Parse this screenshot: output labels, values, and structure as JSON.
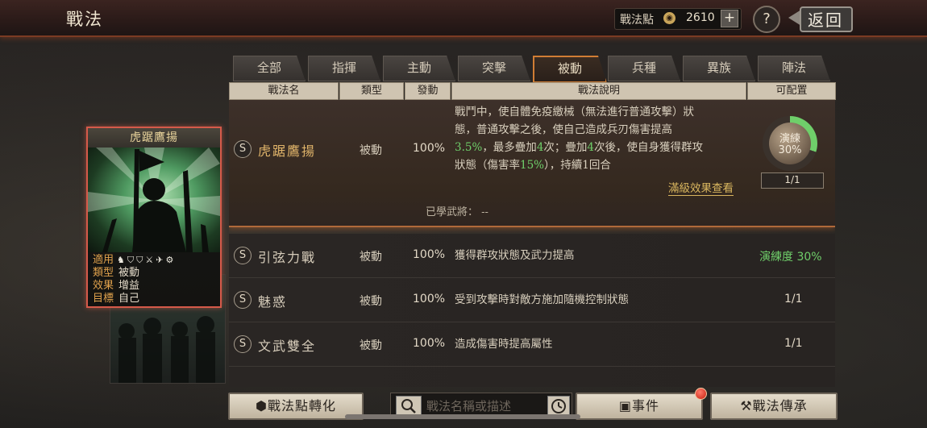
{
  "header": {
    "title": "戰法",
    "points_label": "戰法點",
    "points_value": "2610",
    "plus": "+",
    "help": "?",
    "back": "返回"
  },
  "tabs": [
    {
      "label": "全部",
      "active": false
    },
    {
      "label": "指揮",
      "active": false
    },
    {
      "label": "主動",
      "active": false
    },
    {
      "label": "突擊",
      "active": false
    },
    {
      "label": "被動",
      "active": true
    },
    {
      "label": "兵種",
      "active": false
    },
    {
      "label": "異族",
      "active": false
    },
    {
      "label": "陣法",
      "active": false
    }
  ],
  "columns": {
    "name": "戰法名",
    "type": "類型",
    "rate": "發動",
    "desc": "戰法說明",
    "config": "可配置"
  },
  "selected": {
    "grade": "S",
    "name": "虎踞鷹揚",
    "type": "被動",
    "rate": "100%",
    "desc_lines": [
      [
        "戰鬥中，使自體免疫繳械（無法進行普通攻擊）狀"
      ],
      [
        "態，普通攻擊之後，使自己造成兵刃傷害提高"
      ],
      [
        "3.5%",
        "，最多疊加",
        "4",
        "次；疊加",
        "4",
        "次後，使自身獲得群攻"
      ],
      [
        "狀態（傷害率",
        "15%",
        "），持續",
        "1",
        "回合"
      ]
    ],
    "max_effect_link": "滿級效果查看",
    "learned_label": "已學武將：",
    "learned_value": "--",
    "practice_label": "演練",
    "practice_percent": "30%",
    "practice_fill": 0.3,
    "practice_count": "1/1"
  },
  "rows": [
    {
      "grade": "S",
      "name": "引弦力戰",
      "type": "被動",
      "rate": "100%",
      "desc": "獲得群攻狀態及武力提高",
      "status": "演練度 30%",
      "status_color": "#6fcf6a"
    },
    {
      "grade": "S",
      "name": "魅惑",
      "type": "被動",
      "rate": "100%",
      "desc": "受到攻擊時對敵方施加隨機控制狀態",
      "status": "1/1",
      "status_color": "#e2d8c6"
    },
    {
      "grade": "S",
      "name": "文武雙全",
      "type": "被動",
      "rate": "100%",
      "desc": "造成傷害時提高屬性",
      "status": "1/1",
      "status_color": "#e2d8c6"
    }
  ],
  "card": {
    "title": "虎踞鷹揚",
    "apply_label": "適用",
    "apply_icons": "♞⛉⛉⚔✈⚙",
    "type_label": "類型",
    "type_value": "被動",
    "effect_label": "效果",
    "effect_value": "增益",
    "target_label": "目標",
    "target_value": "自己",
    "border_color": "#d55a4a"
  },
  "bottom": {
    "convert_button": "戰法點轉化",
    "search_placeholder": "戰法名稱或描述",
    "event_button": "事件",
    "inherit_button": "戰法傳承"
  },
  "colors": {
    "accent": "#d07d34",
    "highlight": "#6fcf6a",
    "link": "#d8b55e"
  }
}
